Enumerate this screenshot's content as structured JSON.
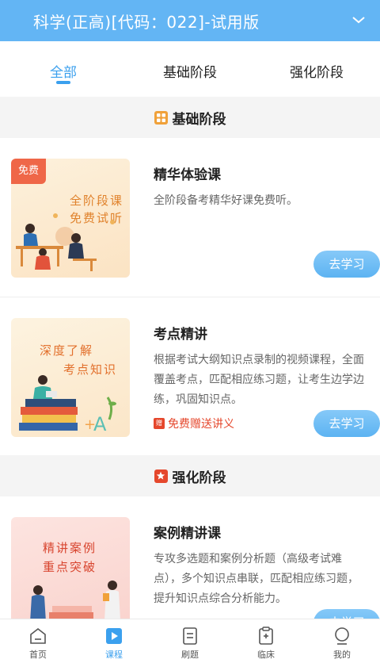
{
  "header": {
    "title": "科学(正高)[代码：022]-试用版"
  },
  "tabs": [
    {
      "label": "全部",
      "active": true
    },
    {
      "label": "基础阶段",
      "active": false
    },
    {
      "label": "强化阶段",
      "active": false
    }
  ],
  "sections": [
    {
      "title": "基础阶段",
      "badge_color": "#f0a13a",
      "courses": [
        {
          "title": "精华体验课",
          "desc": "全阶段备考精华好课免费听。",
          "button": "去学习",
          "thumb": {
            "ribbon": "免费",
            "line1": "全阶段课",
            "line2": "免费试听"
          }
        },
        {
          "title": "考点精讲",
          "desc": "根据考试大纲知识点录制的视频课程，全面覆盖考点，匹配相应练习题，让考生边学边练，巩固知识点。",
          "button": "去学习",
          "gift": "免费赠送讲义",
          "gift_icon": "赠",
          "thumb": {
            "line1": "深度了解",
            "line2": "考点知识"
          }
        }
      ]
    },
    {
      "title": "强化阶段",
      "badge_color": "#e5472c",
      "courses": [
        {
          "title": "案例精讲课",
          "desc": "专攻多选题和案例分析题（高级考试难点），多个知识点串联，匹配相应练习题，提升知识点综合分析能力。",
          "button": "去学习",
          "thumb": {
            "line1": "精讲案例",
            "line2": "重点突破"
          }
        }
      ]
    }
  ],
  "bottom_nav": [
    {
      "label": "首页",
      "icon": "home-icon",
      "active": false
    },
    {
      "label": "课程",
      "icon": "play-icon",
      "active": true
    },
    {
      "label": "刷题",
      "icon": "document-icon",
      "active": false
    },
    {
      "label": "临床",
      "icon": "clipboard-icon",
      "active": false
    },
    {
      "label": "我的",
      "icon": "profile-icon",
      "active": false
    }
  ],
  "colors": {
    "header": "#63b5f4",
    "accent": "#3ba0ee",
    "button": "#5cb3f2",
    "gift": "#e5472c"
  }
}
